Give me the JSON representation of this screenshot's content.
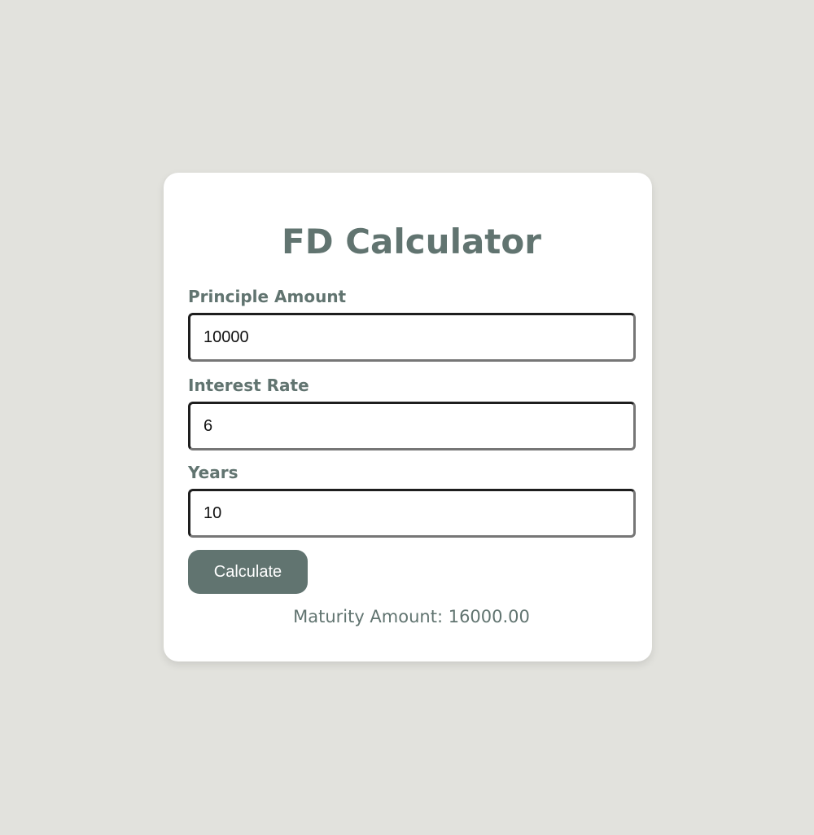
{
  "app": {
    "title": "FD Calculator"
  },
  "form": {
    "principle": {
      "label": "Principle Amount",
      "value": "10000"
    },
    "rate": {
      "label": "Interest Rate",
      "value": "6"
    },
    "years": {
      "label": "Years",
      "value": "10"
    },
    "calculate_label": "Calculate"
  },
  "result": {
    "text": "Maturity Amount: 16000.00"
  },
  "colors": {
    "background": "#e2e2dd",
    "card": "#ffffff",
    "accent": "#617470"
  }
}
